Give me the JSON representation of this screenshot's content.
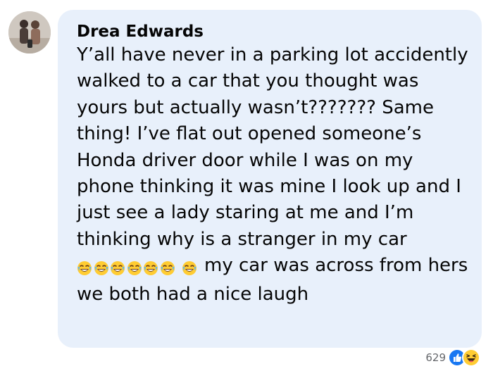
{
  "comment": {
    "author": "Drea Edwards",
    "text_before_emojis": "Y’all have never in a parking lot accidently walked to a car that you thought was yours but actually wasn’t??????? Same thing! I’ve flat out opened someone’s Honda driver door while I was on my phone thinking it was mine I look up and I just see a lady staring at me and I’m thinking why is a stranger in my car",
    "emojis": [
      "tears-of-joy-emoji",
      "tears-of-joy-emoji",
      "tears-of-joy-emoji",
      "tears-of-joy-emoji",
      "tears-of-joy-emoji",
      "tears-of-joy-emoji",
      "tears-of-joy-emoji"
    ],
    "text_after_emojis": "my car was across from hers we both had a nice laugh"
  },
  "reactions": {
    "count": "629",
    "icons": [
      "like-icon",
      "haha-icon"
    ]
  },
  "colors": {
    "bubble": "#e8f0fb",
    "text": "#050505",
    "meta_text": "#65676b",
    "like_blue": "#1877f2",
    "emoji_yellow": "#ffcc33"
  }
}
